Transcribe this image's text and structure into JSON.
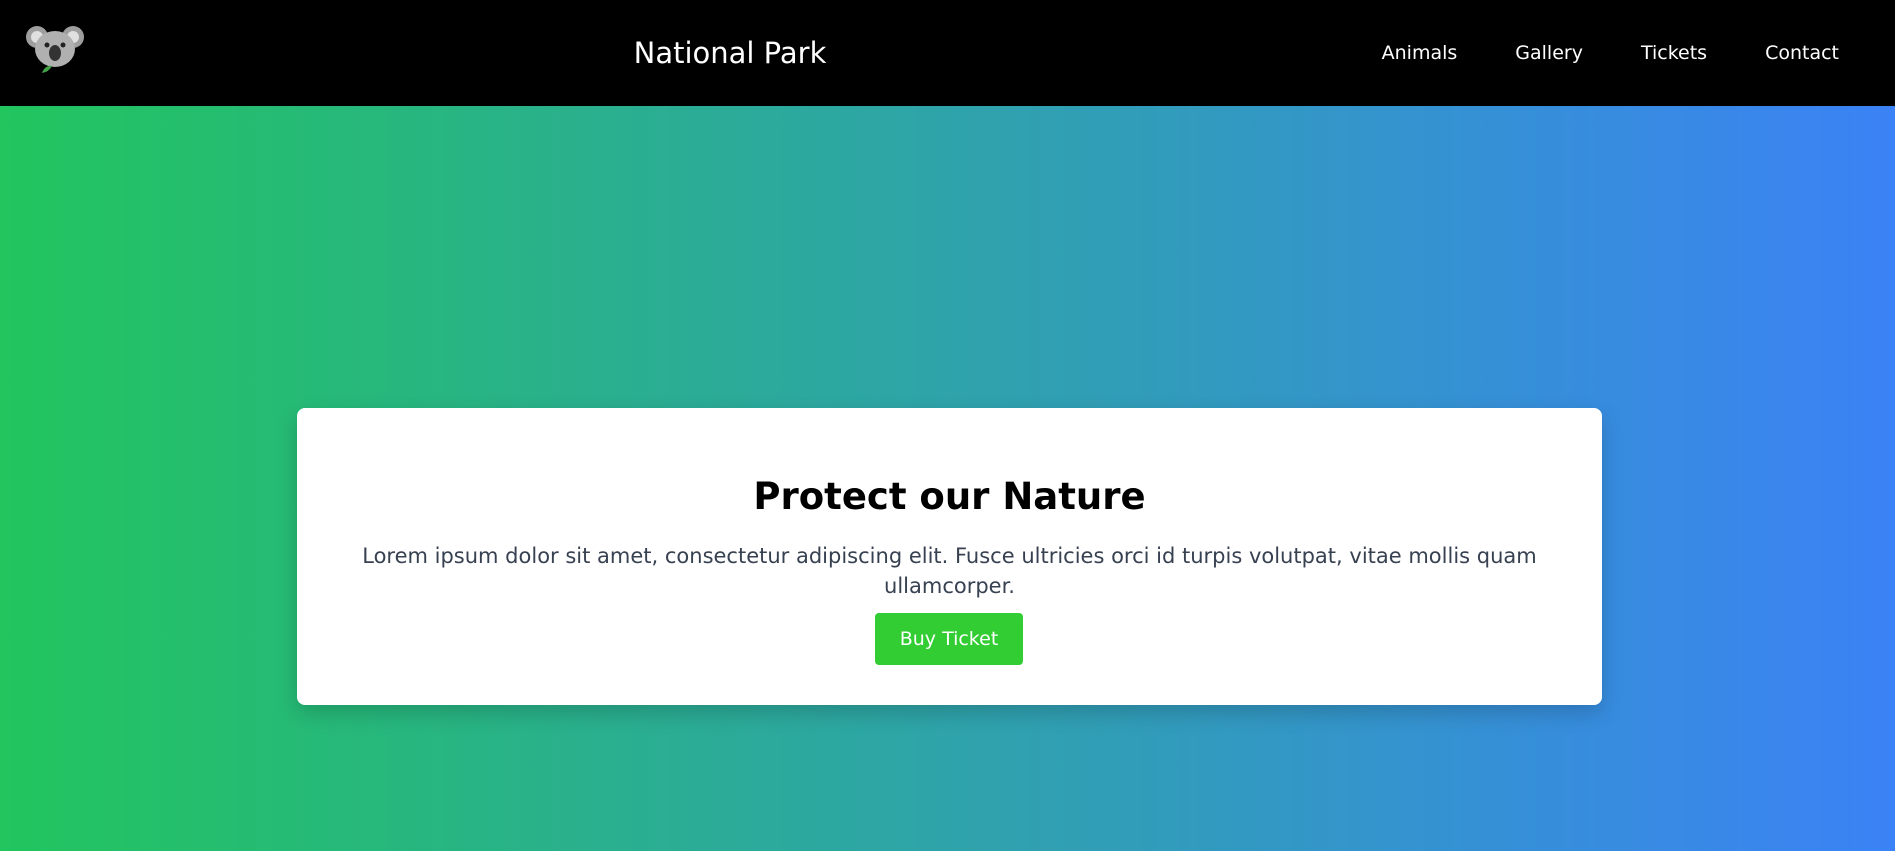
{
  "header": {
    "logo_icon": "koala-icon",
    "title": "National Park",
    "nav": [
      {
        "label": "Animals"
      },
      {
        "label": "Gallery"
      },
      {
        "label": "Tickets"
      },
      {
        "label": "Contact"
      }
    ]
  },
  "hero": {
    "gradient_start": "#22c55e",
    "gradient_end": "#3b82f6",
    "card": {
      "title": "Protect our Nature",
      "text": "Lorem ipsum dolor sit amet, consectetur adipiscing elit. Fusce ultricies orci id turpis volutpat, vitae mollis quam ullamcorper.",
      "button_label": "Buy Ticket",
      "button_color": "#32cd32"
    }
  }
}
